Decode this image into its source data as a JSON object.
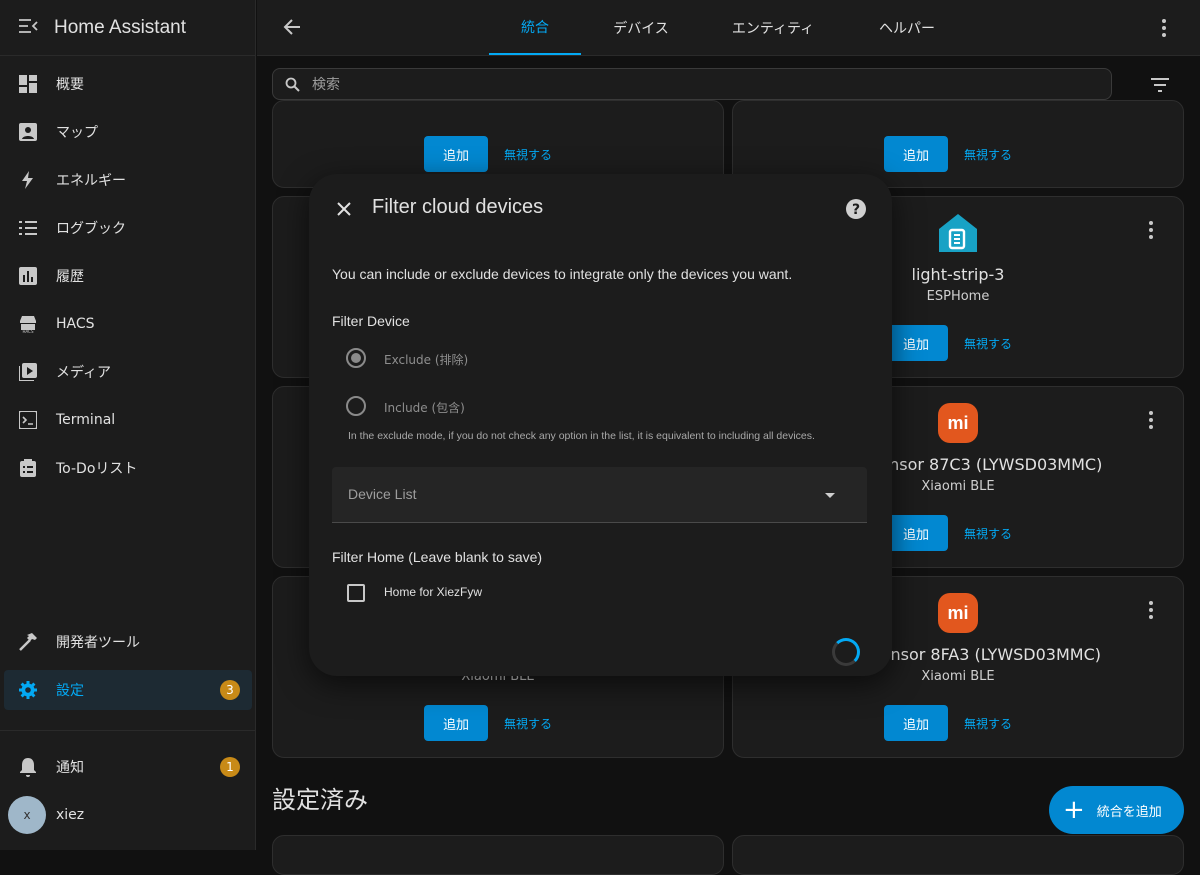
{
  "app": {
    "title": "Home Assistant"
  },
  "sidebar": {
    "items": [
      {
        "label": "概要"
      },
      {
        "label": "マップ"
      },
      {
        "label": "エネルギー"
      },
      {
        "label": "ログブック"
      },
      {
        "label": "履歴"
      },
      {
        "label": "HACS"
      },
      {
        "label": "メディア"
      },
      {
        "label": "Terminal"
      },
      {
        "label": "To-Doリスト"
      },
      {
        "label": "開発者ツール"
      },
      {
        "label": "設定",
        "badge": "3"
      },
      {
        "label": "通知",
        "badge": "1"
      }
    ],
    "user": {
      "name": "xiez",
      "initial": "x"
    }
  },
  "header": {
    "tabs": [
      {
        "label": "統合"
      },
      {
        "label": "デバイス"
      },
      {
        "label": "エンティティ"
      },
      {
        "label": "ヘルパー"
      }
    ]
  },
  "search": {
    "placeholder": "検索"
  },
  "cards": {
    "add_label": "追加",
    "ignore_label": "無視する",
    "light_strip": {
      "title": "light-strip-3",
      "subtitle": "ESPHome"
    },
    "sensor_87c3": {
      "title": "midity Sensor 87C3 (LYWSD03MMC)",
      "subtitle": "Xiaomi BLE"
    },
    "sensor_8fa3": {
      "title": "midity Sensor 8FA3 (LYWSD03MMC)",
      "subtitle": "Xiaomi BLE"
    },
    "left_bottom": {
      "subtitle": "Xiaomi BLE"
    },
    "mi_logo": "mi"
  },
  "configured": {
    "title": "設定済み"
  },
  "fab": {
    "label": "統合を追加"
  },
  "dialog": {
    "title": "Filter cloud devices",
    "description": "You can include or exclude devices to integrate only the devices you want.",
    "filter_device_label": "Filter Device",
    "options": [
      {
        "label": "Exclude (排除)",
        "selected": true
      },
      {
        "label": "Include (包含)",
        "selected": false
      }
    ],
    "helper": "In the exclude mode, if you do not check any option in the list, it is equivalent to including all devices.",
    "device_list_label": "Device List",
    "filter_home_label": "Filter Home (Leave blank to save)",
    "home_option": {
      "label": "Home for XiezFyw",
      "checked": false
    }
  },
  "colors": {
    "accent": "#03a9f4",
    "button": "#0288d1",
    "badge": "#c88a17",
    "mi_brand": "#e2571e"
  }
}
